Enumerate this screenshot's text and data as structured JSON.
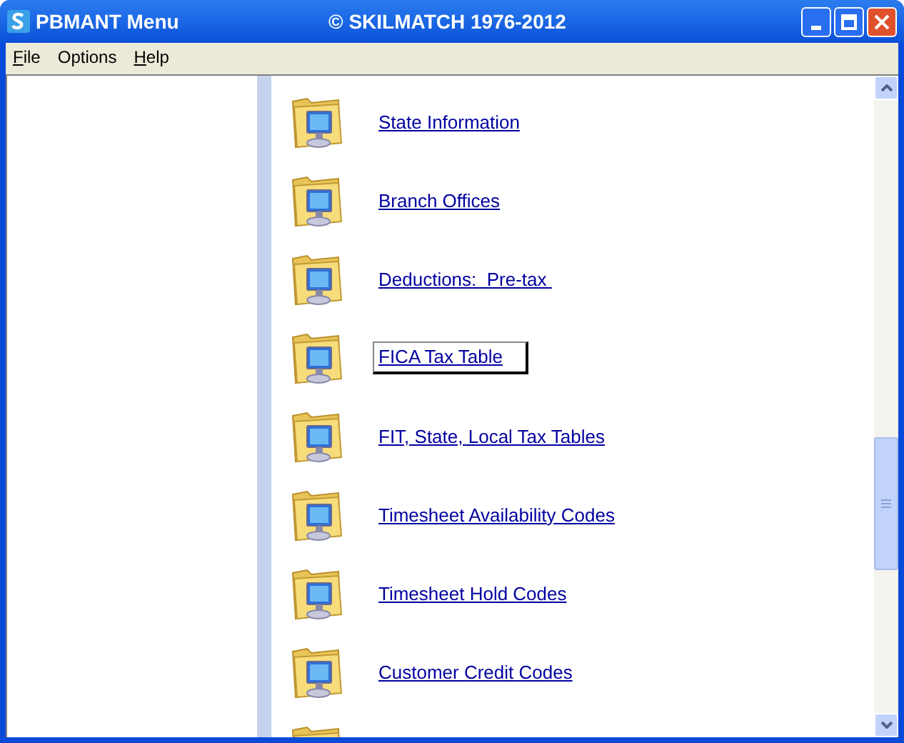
{
  "window": {
    "title": "PBMANT Menu",
    "subtitle": "© SKILMATCH 1976-2012"
  },
  "menu": [
    {
      "label": "File",
      "mnemonic_underlined": true
    },
    {
      "label": "Options",
      "mnemonic_underlined": false
    },
    {
      "label": "Help",
      "mnemonic_underlined": true
    }
  ],
  "items": [
    {
      "label": "State Information",
      "selected": false
    },
    {
      "label": "Branch Offices",
      "selected": false
    },
    {
      "label": "Deductions:  Pre-tax ",
      "selected": false
    },
    {
      "label": "FICA Tax Table",
      "selected": true
    },
    {
      "label": "FIT, State, Local Tax Tables",
      "selected": false
    },
    {
      "label": "Timesheet Availability Codes",
      "selected": false
    },
    {
      "label": "Timesheet Hold Codes",
      "selected": false
    },
    {
      "label": "Customer Credit Codes",
      "selected": false
    }
  ]
}
